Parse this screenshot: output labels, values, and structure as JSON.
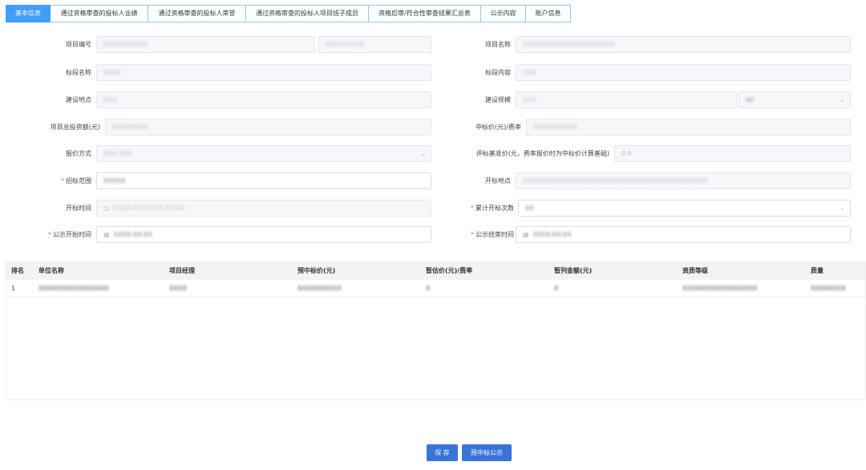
{
  "tabs": [
    {
      "label": "基本信息",
      "active": true
    },
    {
      "label": "通过资格审查的投标人业绩"
    },
    {
      "label": "通过资格审查的投标人荣誉"
    },
    {
      "label": "通过资格审查的投标人项目班子成员"
    },
    {
      "label": "资格后审/符合性审查结果汇总表"
    },
    {
      "label": "公示内容"
    },
    {
      "label": "账户信息"
    }
  ],
  "form": {
    "project_no": {
      "label": "项目编号",
      "value1": "XXXXXXXXXX",
      "value2": "XXXX-XX-XX"
    },
    "project_name": {
      "label": "项目名称",
      "value": "XXXXXXXXXXXXXXXXXXXXX"
    },
    "section_name": {
      "label": "标段名称",
      "value": "XXXX"
    },
    "section_content": {
      "label": "标段内容",
      "value": "XXX"
    },
    "build_location": {
      "label": "建设地点",
      "value": "XXX"
    },
    "build_scale": {
      "label": "建设规模",
      "value": "XXX",
      "unit": "m²"
    },
    "total_investment": {
      "label": "项目总投资额(元)",
      "value": "XXXXXXXX"
    },
    "bid_price": {
      "label": "中标价(元)/费率",
      "value": "XXXXXXXXXX"
    },
    "quote_method": {
      "label": "报价方式",
      "value": "XXX  XXX"
    },
    "bid_base_price": {
      "label": "评标基准价(元，费率报价时为中标价计算基础)",
      "value": "0.0"
    },
    "tender_scope": {
      "label": "招标范围",
      "required": true,
      "value": "XXXXX"
    },
    "opening_location": {
      "label": "开标地点",
      "value": "XXXXXXXXXXXXXXXXXXXXXXXXXXXXXXXXXXXXXXXXXX"
    },
    "opening_time": {
      "label": "开标时间",
      "value": "XXXX-XX-XX XX:XX:XX"
    },
    "cumulative_openings": {
      "label": "累计开标次数",
      "required": true,
      "value": "XX"
    },
    "publicity_start": {
      "label": "公示开始时间",
      "required": true,
      "value": "XXXX-XX-XX"
    },
    "publicity_end": {
      "label": "公示结束时间",
      "required": true,
      "value": "XXXX-XX-XX"
    }
  },
  "table": {
    "headers": [
      "排名",
      "单位名称",
      "项目经理",
      "预中标价(元)",
      "暂估价(元)/费率",
      "暂列金额(元)",
      "资质等级",
      "质量"
    ],
    "rows": [
      [
        "1",
        "XXXXXXXXXXXXXXXX",
        "XXXX",
        "XXXXXXXXXX",
        "X",
        "X",
        "XXXXXXXXXXXXXXXXX",
        "XXXXXXXX"
      ]
    ]
  },
  "buttons": {
    "save": "保 存",
    "pre_win_publicity": "预中标公示"
  }
}
